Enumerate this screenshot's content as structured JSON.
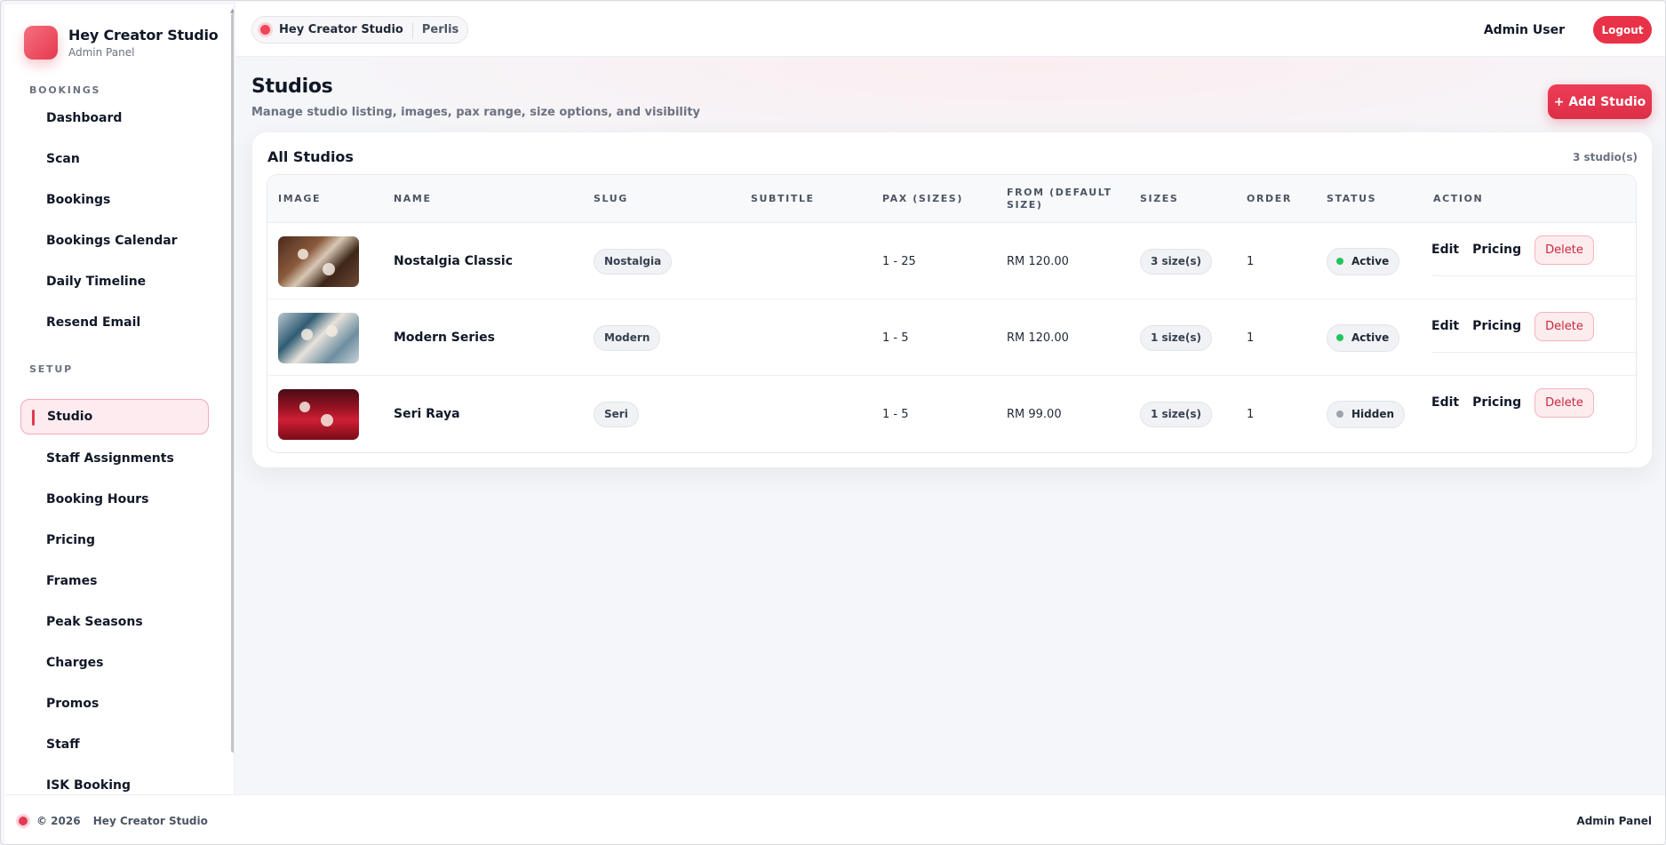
{
  "brand": {
    "title": "Hey Creator Studio",
    "subtitle": "Admin Panel",
    "accent": "#e6394f"
  },
  "sidebar": {
    "sections": [
      {
        "label": "BOOKINGS",
        "items": [
          "Dashboard",
          "Scan",
          "Bookings",
          "Bookings Calendar",
          "Daily Timeline",
          "Resend Email"
        ]
      },
      {
        "label": "SETUP",
        "items": [
          "Studio",
          "Staff Assignments",
          "Booking Hours",
          "Pricing",
          "Frames",
          "Peak Seasons",
          "Charges",
          "Promos",
          "Staff",
          "ISK Booking"
        ]
      }
    ],
    "active_item": "Studio"
  },
  "topbar": {
    "studio_name": "Hey Creator Studio",
    "location": "Perlis",
    "user_name": "Admin User",
    "logout_label": "Logout"
  },
  "page": {
    "title": "Studios",
    "subtitle": "Manage studio listing, images, pax range, size options, and visibility",
    "add_button": "+ Add Studio"
  },
  "table": {
    "title": "All Studios",
    "count": "3 studio(s)",
    "headers": [
      "IMAGE",
      "NAME",
      "SLUG",
      "SUBTITLE",
      "PAX (SIZES)",
      "FROM (DEFAULT SIZE)",
      "SIZES",
      "ORDER",
      "STATUS",
      "ACTION"
    ],
    "rows": [
      {
        "name": "Nostalgia Classic",
        "slug": "Nostalgia",
        "subtitle": "",
        "pax": "1 - 25",
        "from": "RM 120.00",
        "sizes": "3 size(s)",
        "order": "1",
        "status": "Active",
        "status_color": "#22c55e"
      },
      {
        "name": "Modern Series",
        "slug": "Modern",
        "subtitle": "",
        "pax": "1 - 5",
        "from": "RM 120.00",
        "sizes": "1 size(s)",
        "order": "1",
        "status": "Active",
        "status_color": "#22c55e"
      },
      {
        "name": "Seri Raya",
        "slug": "Seri",
        "subtitle": "",
        "pax": "1 - 5",
        "from": "RM 99.00",
        "sizes": "1 size(s)",
        "order": "1",
        "status": "Hidden",
        "status_color": "#9ca3af"
      }
    ],
    "actions": {
      "edit": "Edit",
      "pricing": "Pricing",
      "delete": "Delete"
    }
  },
  "footer": {
    "copyright": "© 2026",
    "brand": "Hey Creator Studio",
    "right": "Admin Panel"
  }
}
